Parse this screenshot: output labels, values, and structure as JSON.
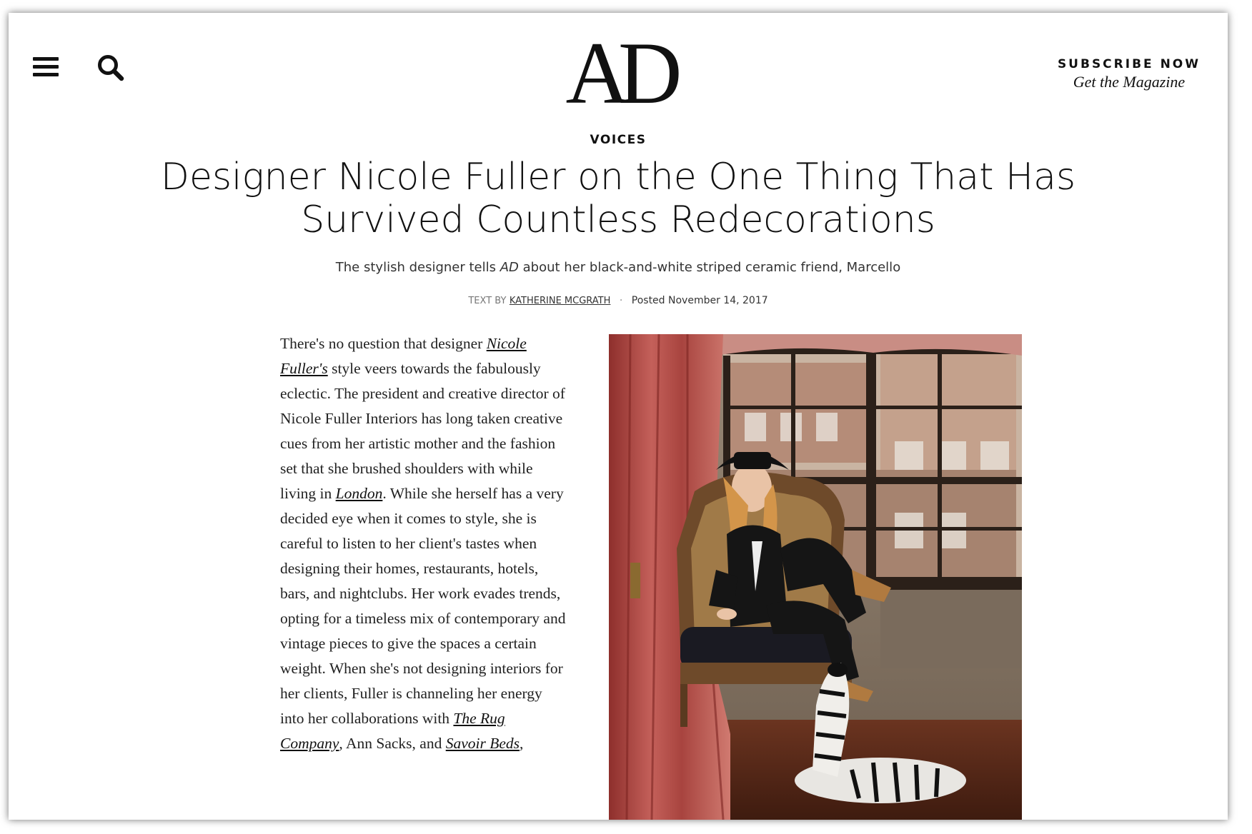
{
  "header": {
    "logo": "AD",
    "subscribe_label": "SUBSCRIBE NOW",
    "magazine_label": "Get the Magazine"
  },
  "article": {
    "rubric": "VOICES",
    "headline": "Designer Nicole Fuller on the One Thing That Has Survived Countless Redecorations",
    "dek_before": "The stylish designer tells ",
    "dek_em": "AD",
    "dek_after": " about her black-and-white striped ceramic friend, Marcello",
    "byline_label": "TEXT BY",
    "author": "KATHERINE MCGRATH",
    "posted": "Posted November 14, 2017",
    "body": {
      "t1": "There's no question that designer ",
      "link_nicole": "Nicole Fuller's",
      "t2": " style veers towards the fabulously eclectic. The president and creative director of Nicole Fuller Interiors has long taken creative cues from her artistic mother and the fashion set that she brushed shoulders with while living in ",
      "link_london": "London",
      "t3": ". While she herself has a very decided eye when it comes to style, she is careful to listen to her client's tastes when designing their homes, restaurants, hotels, bars, and nightclubs. Her work evades trends, opting for a timeless mix of contemporary and vintage pieces to give the spaces a certain weight. When she's not designing interiors for her clients, Fuller is channeling her energy into her collaborations with ",
      "link_rug": "The Rug Company",
      "t4": ", Ann Sacks, and ",
      "link_savoir": "Savoir Beds",
      "t5": ","
    }
  },
  "colors": {
    "text": "#111111",
    "curtain": "#b24a44",
    "wood_floor": "#5a2a18",
    "window_frame": "#2b2019"
  },
  "icons": {
    "menu": "hamburger-icon",
    "search": "search-icon"
  }
}
